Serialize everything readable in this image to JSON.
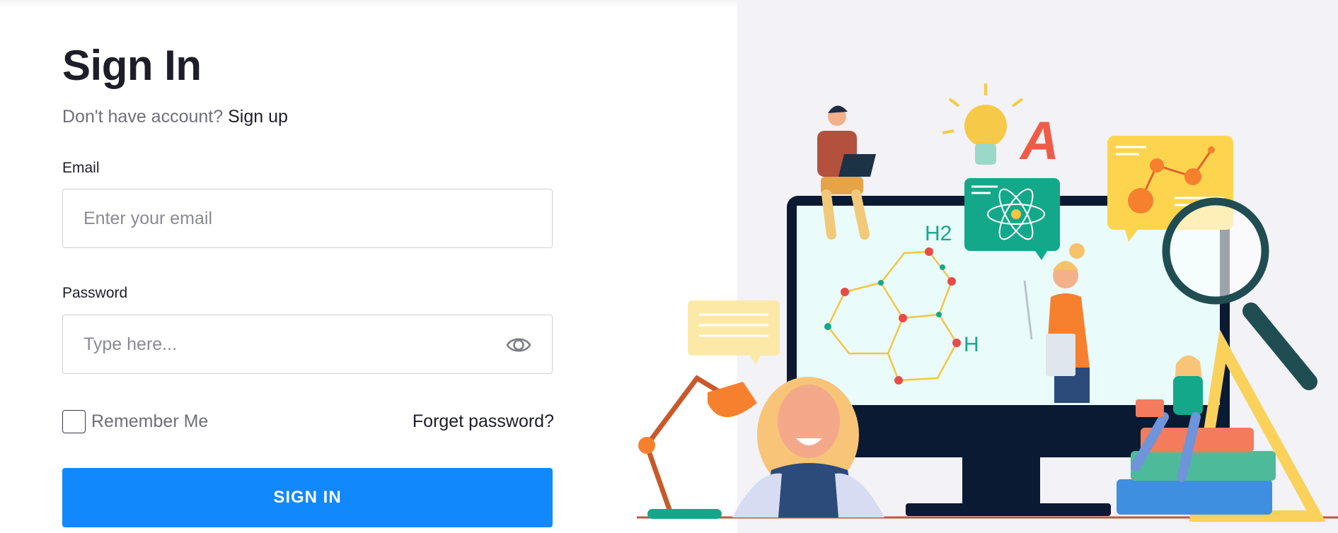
{
  "page": {
    "title": "Sign In"
  },
  "signup": {
    "prompt": "Don't have account?",
    "link": "Sign up"
  },
  "email": {
    "label": "Email",
    "placeholder": "Enter your email",
    "value": ""
  },
  "password": {
    "label": "Password",
    "placeholder": "Type here...",
    "value": "",
    "toggle_icon": "eye-icon"
  },
  "remember": {
    "label": "Remember Me",
    "checked": false
  },
  "forgot": {
    "label": "Forget password?"
  },
  "submit": {
    "label": "SIGN IN"
  },
  "illustration": {
    "formula_h2": "H2",
    "formula_h": "H",
    "letter": "A"
  },
  "colors": {
    "primary": "#1188fb",
    "panel_bg": "#f3f2f7",
    "text_dark": "#1e1e28",
    "text_muted": "#6f6f78"
  }
}
